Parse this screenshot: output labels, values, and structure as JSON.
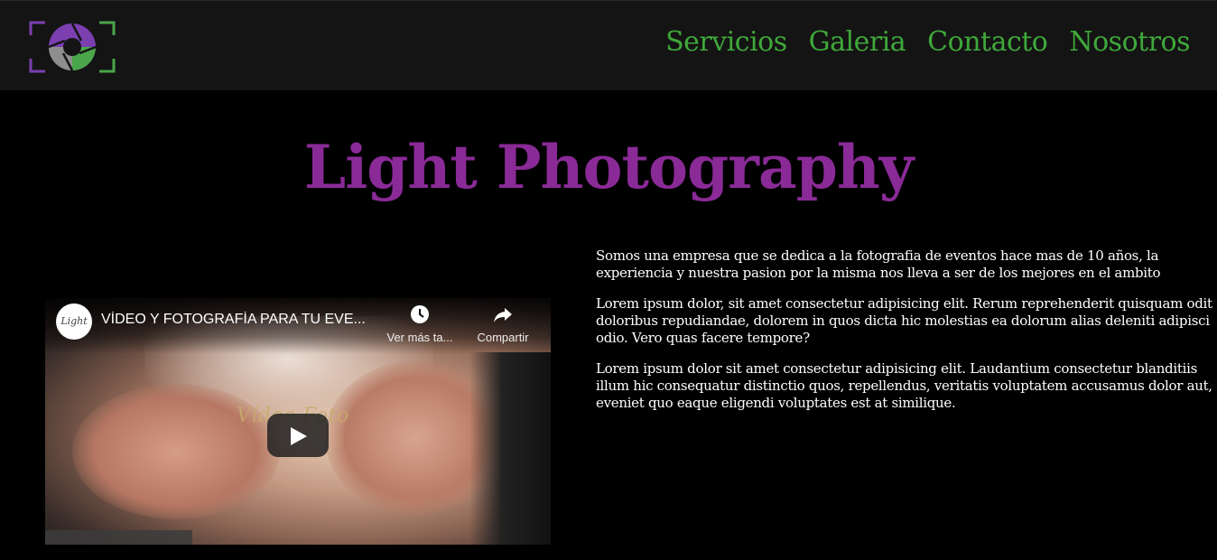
{
  "nav": {
    "links": [
      "Servicios",
      "Galeria",
      "Contacto",
      "Nosotros"
    ]
  },
  "hero": {
    "title": "Light Photography"
  },
  "video": {
    "channel_name": "Light",
    "title": "VÍDEO Y FOTOGRAFÍA PARA TU EVE...",
    "watch_later_label": "Ver más ta...",
    "share_label": "Compartir",
    "watermark_text": "Vídeo Foto"
  },
  "about": {
    "paragraphs": [
      "Somos una empresa que se dedica a la fotografia de eventos hace mas de 10 años, la experiencia y nuestra pasion por la misma nos lleva a ser de los mejores en el ambito",
      "Lorem ipsum dolor, sit amet consectetur adipisicing elit. Rerum reprehenderit quisquam odit doloribus repudiandae, dolorem in quos dicta hic molestias ea dolorum alias deleniti adipisci odio. Vero quas facere tempore?",
      "Lorem ipsum dolor sit amet consectetur adipisicing elit. Laudantium consectetur blanditiis illum hic consequatur distinctio quos, repellendus, veritatis voluptatem accusamus dolor aut, eveniet quo eaque eligendi voluptates est at similique."
    ]
  },
  "colors": {
    "nav_link": "#3fa83a",
    "title": "#8a2a97",
    "navbar_bg": "#141414",
    "page_bg": "#000000"
  },
  "icons": {
    "logo": "camera-aperture-logo",
    "watch_later": "clock-icon",
    "share": "share-arrow-icon",
    "play": "play-icon"
  }
}
